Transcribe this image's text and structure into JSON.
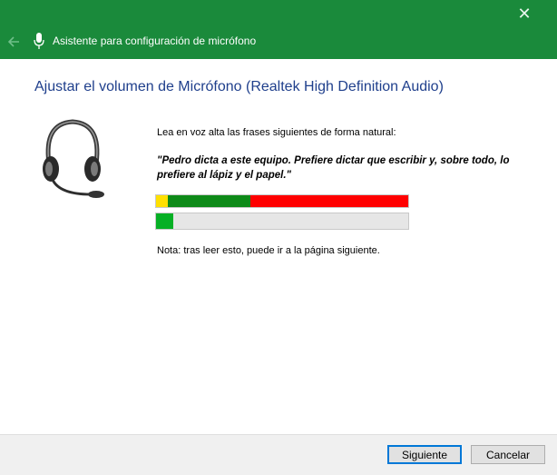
{
  "window": {
    "close_glyph": "✕",
    "title": "Asistente para configuración de micrófono"
  },
  "page": {
    "heading": "Ajustar el volumen de Micrófono (Realtek High Definition Audio)",
    "instruction": "Lea en voz alta las frases siguientes de forma natural:",
    "phrase": "\"Pedro dicta a este equipo. Prefiere dictar que escribir y, sobre todo, lo prefiere al lápiz y el papel.\"",
    "note": "Nota: tras leer esto, puede ir a la página siguiente.",
    "input_level_fraction": 0.07
  },
  "buttons": {
    "next": "Siguiente",
    "cancel": "Cancelar"
  },
  "colors": {
    "titlebar": "#1a8a3b",
    "heading": "#1f3f8c",
    "meter_yellow": "#ffe000",
    "meter_green": "#0e8a18",
    "meter_red": "#ff0000",
    "level_fill": "#06b025"
  },
  "icons": {
    "back": "back-arrow-icon",
    "mic": "microphone-icon",
    "close": "close-icon",
    "headset": "headset-icon"
  }
}
